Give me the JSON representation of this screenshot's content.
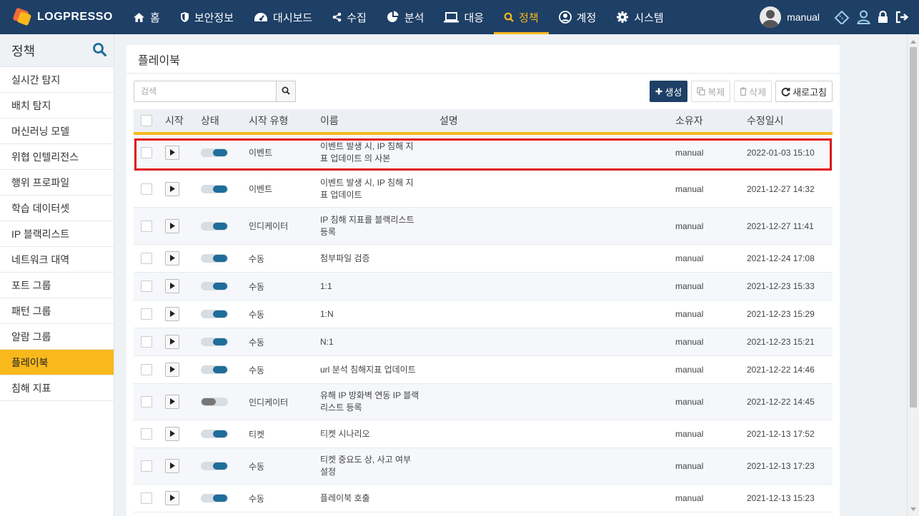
{
  "brand": {
    "name": "LOGPRESSO"
  },
  "nav": {
    "items": [
      {
        "label": "홈",
        "icon": "home-icon"
      },
      {
        "label": "보안정보",
        "icon": "shield-icon"
      },
      {
        "label": "대시보드",
        "icon": "dashboard-icon"
      },
      {
        "label": "수집",
        "icon": "share-icon"
      },
      {
        "label": "분석",
        "icon": "pie-chart-icon"
      },
      {
        "label": "대응",
        "icon": "laptop-icon"
      },
      {
        "label": "정책",
        "icon": "search-icon",
        "active": true
      },
      {
        "label": "계정",
        "icon": "user-circle-icon"
      },
      {
        "label": "시스템",
        "icon": "gear-icon"
      }
    ],
    "active_color": "#f9b81b"
  },
  "user": {
    "name": "manual"
  },
  "sidebar": {
    "title": "정책",
    "items": [
      {
        "label": "실시간 탐지"
      },
      {
        "label": "배치 탐지"
      },
      {
        "label": "머신러닝 모델"
      },
      {
        "label": "위협 인텔리전스"
      },
      {
        "label": "행위 프로파일"
      },
      {
        "label": "학습 데이터셋"
      },
      {
        "label": "IP 블랙리스트"
      },
      {
        "label": "네트워크 대역"
      },
      {
        "label": "포트 그룹"
      },
      {
        "label": "패턴 그룹"
      },
      {
        "label": "알람 그룹"
      },
      {
        "label": "플레이북",
        "active": true
      },
      {
        "label": "침해 지표"
      }
    ]
  },
  "panel": {
    "title": "플레이북"
  },
  "toolbar": {
    "search_placeholder": "검색",
    "create_label": "생성",
    "copy_label": "복제",
    "delete_label": "삭제",
    "refresh_label": "새로고침"
  },
  "table": {
    "headers": {
      "start": "시작",
      "state": "상태",
      "start_type": "시작 유형",
      "name": "이름",
      "description": "설명",
      "owner": "소유자",
      "modified": "수정일시"
    },
    "rows": [
      {
        "enabled": true,
        "start_type": "이벤트",
        "name_line1": "이벤트 발생 시, IP 침해 지",
        "name_line2": "표 업데이트 의 사본",
        "description": "",
        "owner": "manual",
        "modified": "2022-01-03 15:10"
      },
      {
        "enabled": true,
        "start_type": "이벤트",
        "name_line1": "이벤트 발생 시, IP 침해 지",
        "name_line2": "표 업데이트",
        "description": "",
        "owner": "manual",
        "modified": "2021-12-27 14:32"
      },
      {
        "enabled": true,
        "start_type": "인디케이터",
        "name_line1": "IP 침해 지표를 블랙리스트",
        "name_line2": "등록",
        "description": "",
        "owner": "manual",
        "modified": "2021-12-27 11:41"
      },
      {
        "enabled": true,
        "start_type": "수동",
        "name_line1": "첨부파일 검증",
        "name_line2": "",
        "description": "",
        "owner": "manual",
        "modified": "2021-12-24 17:08"
      },
      {
        "enabled": true,
        "start_type": "수동",
        "name_line1": "1:1",
        "name_line2": "",
        "description": "",
        "owner": "manual",
        "modified": "2021-12-23 15:33"
      },
      {
        "enabled": true,
        "start_type": "수동",
        "name_line1": "1:N",
        "name_line2": "",
        "description": "",
        "owner": "manual",
        "modified": "2021-12-23 15:29"
      },
      {
        "enabled": true,
        "start_type": "수동",
        "name_line1": "N:1",
        "name_line2": "",
        "description": "",
        "owner": "manual",
        "modified": "2021-12-23 15:21"
      },
      {
        "enabled": true,
        "start_type": "수동",
        "name_line1": "url 분석 침해지표 업데이트",
        "name_line2": "",
        "description": "",
        "owner": "manual",
        "modified": "2021-12-22 14:46"
      },
      {
        "enabled": false,
        "start_type": "인디케이터",
        "name_line1": "유해 IP 방화벽 연동 IP 블랙",
        "name_line2": "리스트 등록",
        "description": "",
        "owner": "manual",
        "modified": "2021-12-22 14:45"
      },
      {
        "enabled": true,
        "start_type": "티켓",
        "name_line1": "티켓 시나리오",
        "name_line2": "",
        "description": "",
        "owner": "manual",
        "modified": "2021-12-13 17:52"
      },
      {
        "enabled": true,
        "start_type": "수동",
        "name_line1": "티켓 중요도 상, 사고 여부",
        "name_line2": "설정",
        "description": "",
        "owner": "manual",
        "modified": "2021-12-13 17:23"
      },
      {
        "enabled": true,
        "start_type": "수동",
        "name_line1": "플레이북 호출",
        "name_line2": "",
        "description": "",
        "owner": "manual",
        "modified": "2021-12-13 15:23"
      }
    ]
  },
  "highlight_color": "#e0131a"
}
